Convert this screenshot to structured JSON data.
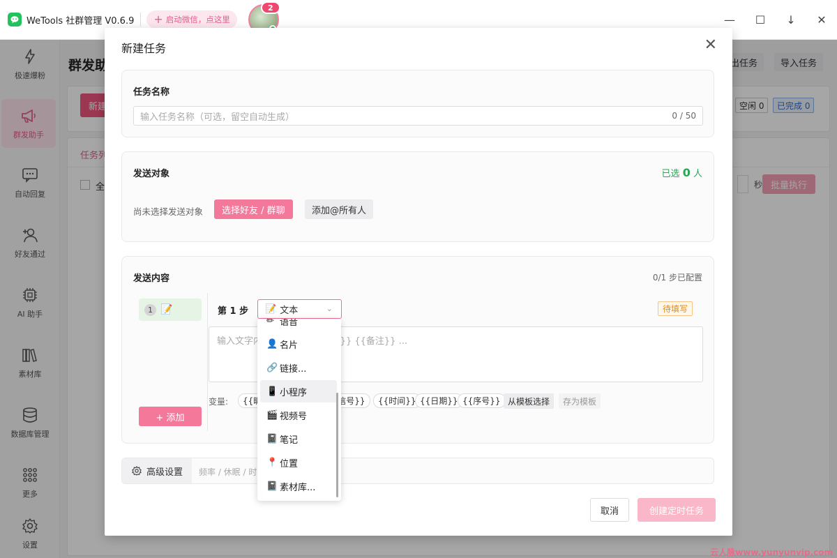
{
  "app": {
    "title": "WeTools 社群管理 V0.6.9",
    "wechat_button": "启动微信，点这里",
    "avatar_badge": "2"
  },
  "sidebar": {
    "items": [
      {
        "label": "极速爆粉",
        "icon": "bolt-icon"
      },
      {
        "label": "群发助手",
        "icon": "megaphone-icon"
      },
      {
        "label": "自动回复",
        "icon": "chat-icon"
      },
      {
        "label": "好友通过",
        "icon": "user-add-icon"
      },
      {
        "label": "AI 助手",
        "icon": "chip-icon"
      },
      {
        "label": "素材库",
        "icon": "books-icon"
      },
      {
        "label": "数据库管理",
        "icon": "database-icon"
      },
      {
        "label": "更多",
        "icon": "grid-icon"
      },
      {
        "label": "设置",
        "icon": "gear-icon"
      }
    ]
  },
  "background": {
    "title": "群发助",
    "export_btn": "出任务",
    "import_btn": "导入任务",
    "new_btn": "新建",
    "idle_tag": "空闲 0",
    "done_tag": "已完成 0",
    "tab": "任务列",
    "select_all": "全",
    "seconds": "秒",
    "batch_btn": "批量执行"
  },
  "modal": {
    "title": "新建任务",
    "task_name": {
      "label": "任务名称",
      "placeholder": "输入任务名称（可选，留空自动生成）",
      "counter": "0 / 50"
    },
    "target": {
      "label": "发送对象",
      "selected_prefix": "已选",
      "selected_count": "0",
      "selected_suffix": "人",
      "empty_text": "尚未选择发送对象",
      "select_btn": "选择好友 / 群聊",
      "at_all_btn": "添加@所有人"
    },
    "content": {
      "label": "发送内容",
      "progress": "0/1 步已配置",
      "step_num": "1",
      "step_title": "第 1 步",
      "type_value": "文本",
      "status": "待填写",
      "placeholder": "输入文字内容，可使用 {{昵称}} {{备注}} ...",
      "vars_label": "变量:",
      "vars": [
        "{{昵称}}",
        "{{微信号}}",
        "{{时间}}",
        "{{日期}}",
        "{{序号}}"
      ],
      "template_btn": "从模板选择",
      "save_template_btn": "存为模板",
      "add_btn": "+ 添加"
    },
    "advanced": {
      "label": "高级设置",
      "hint": "频率 / 休眠 / 时"
    },
    "cancel_btn": "取消",
    "create_btn": "创建定时任务"
  },
  "dropdown": {
    "items": [
      {
        "label": "语音",
        "icon": "pen-icon"
      },
      {
        "label": "名片",
        "icon": "person-icon"
      },
      {
        "label": "链接...",
        "icon": "link-icon"
      },
      {
        "label": "小程序",
        "icon": "phone-icon"
      },
      {
        "label": "视频号",
        "icon": "clapper-icon"
      },
      {
        "label": "笔记",
        "icon": "notebook-icon"
      },
      {
        "label": "位置",
        "icon": "pin-icon"
      },
      {
        "label": "素材库...",
        "icon": "notebook-icon"
      }
    ],
    "hovered_index": 3
  },
  "watermark": "云人脉www.yunyunvip.com",
  "colors": {
    "accent_pink": "#f4789a",
    "success_green": "#2ba454",
    "warning_orange": "#e08a12"
  }
}
